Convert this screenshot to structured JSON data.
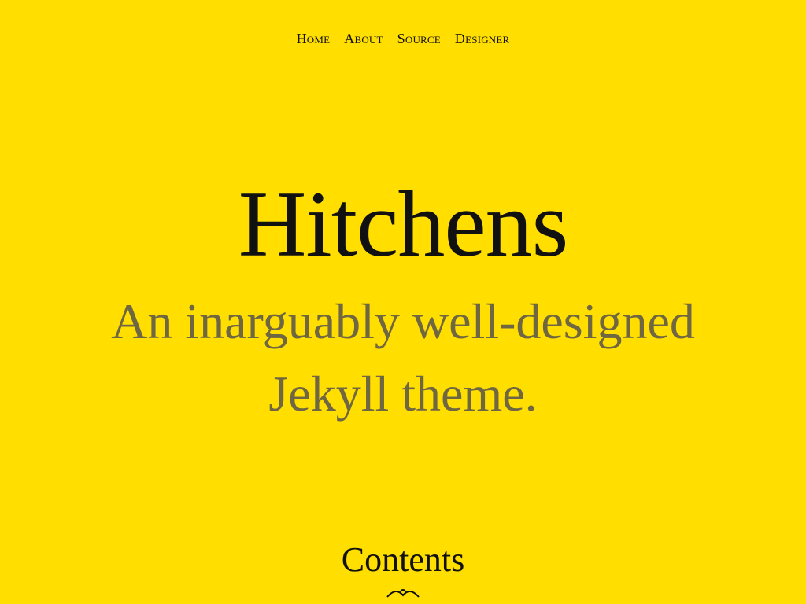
{
  "nav": {
    "items": [
      {
        "label": "Home"
      },
      {
        "label": "About"
      },
      {
        "label": "Source"
      },
      {
        "label": "Designer"
      }
    ]
  },
  "hero": {
    "title": "Hitchens",
    "tagline": "An inarguably well-designed Jekyll theme."
  },
  "contents": {
    "heading": "Contents",
    "ornament_icon": "ornament-icon"
  },
  "colors": {
    "background": "#FFDE00",
    "title_text": "#111111",
    "tagline_text": "#6F6642"
  }
}
